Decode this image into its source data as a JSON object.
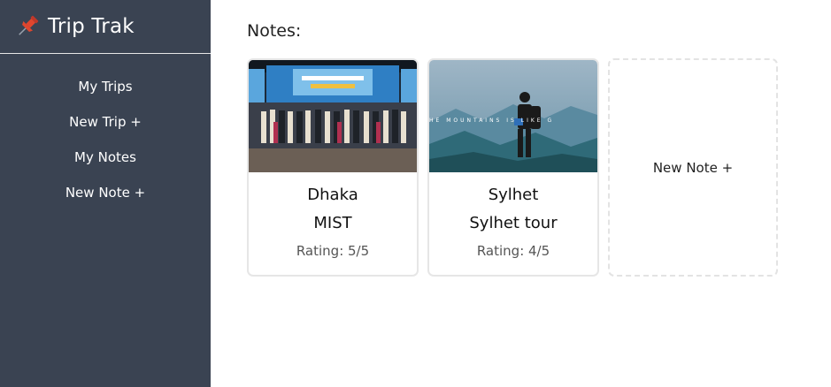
{
  "app": {
    "title": "Trip Trak",
    "logo_icon": "pushpin-icon"
  },
  "sidebar": {
    "items": [
      {
        "label": "My Trips"
      },
      {
        "label": "New Trip +"
      },
      {
        "label": "My Notes"
      },
      {
        "label": "New Note +"
      }
    ]
  },
  "main": {
    "heading": "Notes:",
    "notes": [
      {
        "city": "Dhaka",
        "name": "MIST",
        "rating": "Rating: 5/5",
        "image": "group-photo-closing-ceremony"
      },
      {
        "city": "Sylhet",
        "name": "Sylhet tour",
        "rating": "Rating: 4/5",
        "image": "hiker-mountains-mist",
        "image_text": "HE MOUNTAINS IS LIKE G"
      }
    ],
    "new_note_label": "New Note +"
  },
  "colors": {
    "sidebar_bg": "#3a4352",
    "pin": "#e0462e"
  }
}
